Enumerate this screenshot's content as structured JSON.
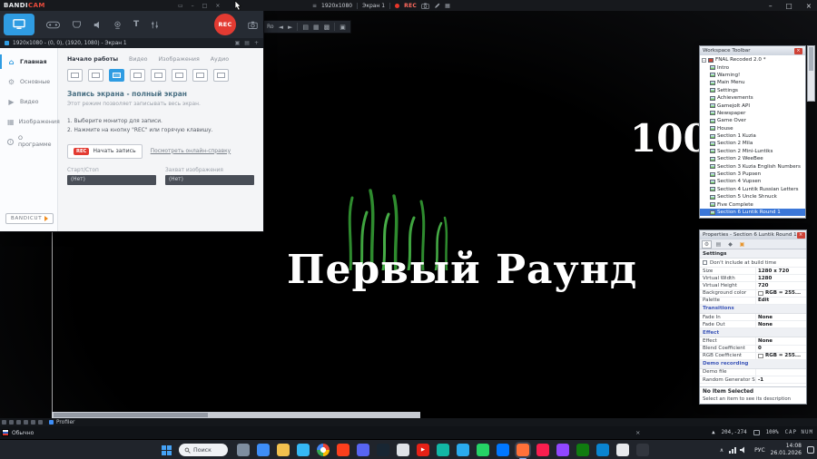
{
  "colors": {
    "accent_blue": "#2f9ce2",
    "rec_red": "#e33b32",
    "selection_blue": "#3b77d8"
  },
  "game": {
    "round_title": "Первый Раунд",
    "counter": "100"
  },
  "top_bar": {
    "logo_white": "BANDI",
    "logo_red": "CAM",
    "resolution": "1920x1080",
    "screen": "Экран 1",
    "rec": "REC",
    "minimize": "–",
    "maximize": "□",
    "close": "×"
  },
  "floating_toolbar": {
    "label": "Ro",
    "prev": "◄",
    "next": "►"
  },
  "bandicam": {
    "status": "1920x1080 - (0, 0), (1920, 1080) - Экран 1",
    "rec_button": "REC",
    "sidebar": [
      {
        "label": "Главная",
        "glyph": "⌂",
        "active": true
      },
      {
        "label": "Основные",
        "glyph": "⚙",
        "active": false
      },
      {
        "label": "Видео",
        "glyph": "▶",
        "active": false
      },
      {
        "label": "Изображения",
        "glyph": "▦",
        "active": false
      },
      {
        "label": "О программе",
        "glyph": "i",
        "active": false
      }
    ],
    "tabs": [
      {
        "label": "Начало работы",
        "active": true
      },
      {
        "label": "Видео",
        "active": false
      },
      {
        "label": "Изображения",
        "active": false
      },
      {
        "label": "Аудио",
        "active": false
      }
    ],
    "modes": [
      false,
      false,
      true,
      false,
      false,
      false,
      false,
      false
    ],
    "heading": "Запись экрана - полный экран",
    "description": "Этот режим позволяет записывать весь экран.",
    "steps": [
      "1. Выберите монитор для записи.",
      "2. Нажмите на кнопку \"REC\" или горячую клавишу."
    ],
    "start_badge": "REC",
    "start_label": "Начать запись",
    "help_link": "Посмотреть онлайн-справку",
    "fields": [
      {
        "label": "Старт/Стоп",
        "value": "(Нет)"
      },
      {
        "label": "Захват изображения",
        "value": "(Нет)"
      }
    ],
    "bandicut": "BANDICUT"
  },
  "workspace": {
    "title": "Workspace Toolbar",
    "tree": [
      {
        "label": "FNAL Recoded 2.0 *",
        "level": 0,
        "root": true,
        "selected": false
      },
      {
        "label": "Intro",
        "level": 1,
        "root": false,
        "selected": false
      },
      {
        "label": "Warning!",
        "level": 1,
        "root": false,
        "selected": false
      },
      {
        "label": "Main Menu",
        "level": 1,
        "root": false,
        "selected": false
      },
      {
        "label": "Settings",
        "level": 1,
        "root": false,
        "selected": false
      },
      {
        "label": "Achievements",
        "level": 1,
        "root": false,
        "selected": false
      },
      {
        "label": "Gamejolt API",
        "level": 1,
        "root": false,
        "selected": false
      },
      {
        "label": "Newspaper",
        "level": 1,
        "root": false,
        "selected": false
      },
      {
        "label": "Game Over",
        "level": 1,
        "root": false,
        "selected": false
      },
      {
        "label": "House",
        "level": 1,
        "root": false,
        "selected": false
      },
      {
        "label": "Section 1 Kuzia",
        "level": 1,
        "root": false,
        "selected": false
      },
      {
        "label": "Section 2 Mila",
        "level": 1,
        "root": false,
        "selected": false
      },
      {
        "label": "Section 2 Mini-Luntiks",
        "level": 1,
        "root": false,
        "selected": false
      },
      {
        "label": "Section 2 WeeBee",
        "level": 1,
        "root": false,
        "selected": false
      },
      {
        "label": "Section 3 Kuzia English Numbers",
        "level": 1,
        "root": false,
        "selected": false
      },
      {
        "label": "Section 3 Pupsen",
        "level": 1,
        "root": false,
        "selected": false
      },
      {
        "label": "Section 4 Vupsen",
        "level": 1,
        "root": false,
        "selected": false
      },
      {
        "label": "Section 4 Luntik Russian Letters",
        "level": 1,
        "root": false,
        "selected": false
      },
      {
        "label": "Section 5 Uncle Shnuck",
        "level": 1,
        "root": false,
        "selected": false
      },
      {
        "label": "Five Complete",
        "level": 1,
        "root": false,
        "selected": false
      },
      {
        "label": "Section 6 Luntik Round 1",
        "level": 1,
        "root": false,
        "selected": true
      }
    ]
  },
  "properties": {
    "title": "Properties - Section 6 Luntik Round 1",
    "rows": [
      {
        "type": "header",
        "label": "Settings",
        "blue": false
      },
      {
        "type": "checkbox",
        "label": "Don't include at build time"
      },
      {
        "type": "kv",
        "label": "Size",
        "value": "1280 x 720",
        "swatch": false
      },
      {
        "type": "kv",
        "label": "Virtual Width",
        "value": "1280",
        "swatch": false
      },
      {
        "type": "kv",
        "label": "Virtual Height",
        "value": "720",
        "swatch": false
      },
      {
        "type": "kv",
        "label": "Background color",
        "value": "RGB = 255...",
        "swatch": true
      },
      {
        "type": "kv",
        "label": "Palette",
        "value": "Edit",
        "swatch": false
      },
      {
        "type": "header",
        "label": "Transitions",
        "blue": true
      },
      {
        "type": "kv",
        "label": "Fade In",
        "value": "None",
        "swatch": false
      },
      {
        "type": "kv",
        "label": "Fade Out",
        "value": "None",
        "swatch": false
      },
      {
        "type": "header",
        "label": "Effect",
        "blue": true
      },
      {
        "type": "kv",
        "label": "Effect",
        "value": "None",
        "swatch": false
      },
      {
        "type": "kv",
        "label": "Blend Coefficient",
        "value": "0",
        "swatch": false
      },
      {
        "type": "kv",
        "label": "RGB Coefficient",
        "value": "RGB = 255...",
        "swatch": true
      },
      {
        "type": "header",
        "label": "Demo recording",
        "blue": true
      },
      {
        "type": "kv",
        "label": "Demo file",
        "value": "",
        "swatch": false
      },
      {
        "type": "kv",
        "label": "Random Generator Seed",
        "value": "-1",
        "swatch": false
      }
    ],
    "no_selection_title": "No Item Selected",
    "no_selection_text": "Select an item to see its description"
  },
  "fusion": {
    "profiler": "Profiler",
    "mode": "Обычно",
    "scroll_arrow": "▲",
    "coords": "204,-274",
    "zoom": "100%",
    "locks": "CAP NUM",
    "close": "×"
  },
  "taskbar": {
    "search": "Поиск",
    "language": "РУС",
    "time": "14:08",
    "date": "26.01.2026",
    "apps": [
      {
        "color": "#7f8ea0",
        "style": "plain",
        "active": false
      },
      {
        "color": "#3e8ef7",
        "style": "plain",
        "active": false
      },
      {
        "color": "#f2c14e",
        "style": "plain",
        "active": false
      },
      {
        "color": "#35b8f5",
        "style": "plain",
        "active": false
      },
      {
        "color": "",
        "style": "chrome",
        "active": false
      },
      {
        "color": "#fc3f1d",
        "style": "plain",
        "active": false
      },
      {
        "color": "#5865f2",
        "style": "plain",
        "active": false
      },
      {
        "color": "#182633",
        "style": "plain",
        "active": false
      },
      {
        "color": "#dfe3e8",
        "style": "plain",
        "active": false
      },
      {
        "color": "#e62117",
        "style": "play",
        "active": false
      },
      {
        "color": "#12b7a5",
        "style": "plain",
        "active": false
      },
      {
        "color": "#2aabee",
        "style": "plain",
        "active": false
      },
      {
        "color": "#25d366",
        "style": "plain",
        "active": false
      },
      {
        "color": "#0077ff",
        "style": "plain",
        "active": false
      },
      {
        "color": "#ff7139",
        "style": "plain",
        "active": true
      },
      {
        "color": "#fa1e4e",
        "style": "plain",
        "active": false
      },
      {
        "color": "#9147ff",
        "style": "plain",
        "active": false
      },
      {
        "color": "#107c10",
        "style": "plain",
        "active": false
      },
      {
        "color": "#0a84d0",
        "style": "plain",
        "active": false
      },
      {
        "color": "#e8eaed",
        "style": "plain",
        "active": false
      },
      {
        "color": "#32363e",
        "style": "plain",
        "active": false
      }
    ]
  }
}
